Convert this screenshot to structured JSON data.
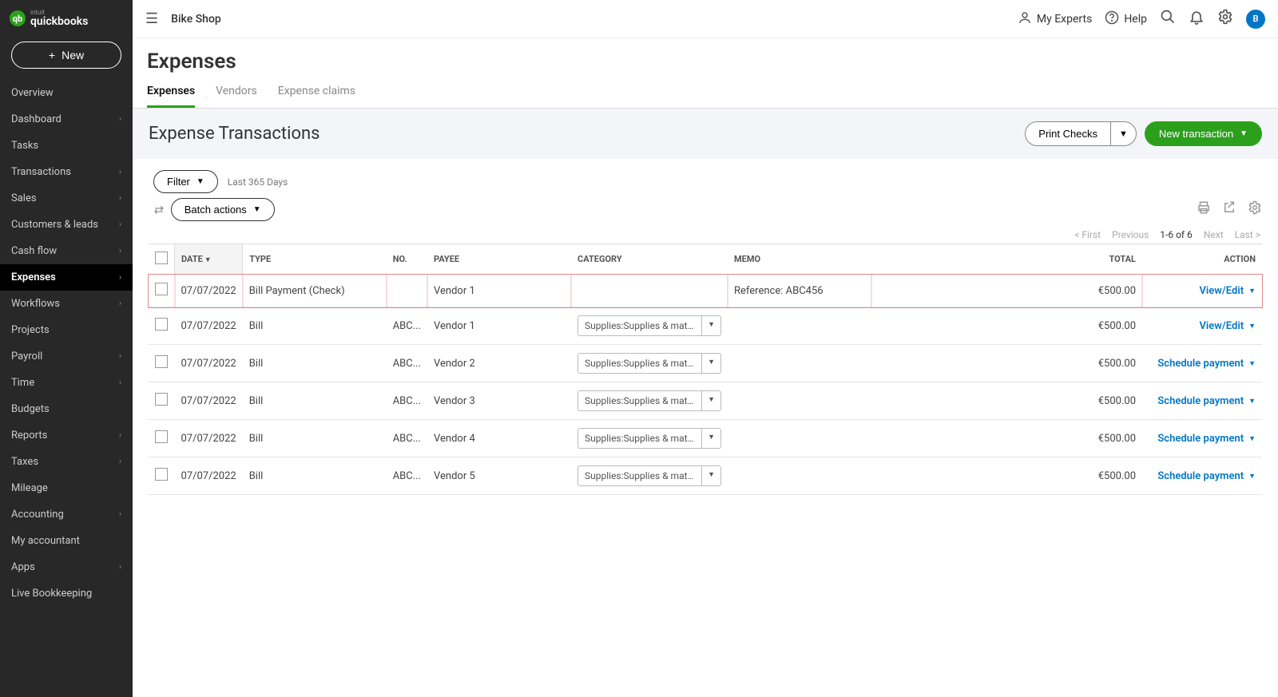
{
  "brand": {
    "intuit": "intuit",
    "name": "quickbooks",
    "icon_letter": "qb"
  },
  "sidebar": {
    "new_label": "New",
    "items": [
      {
        "label": "Overview",
        "chev": false
      },
      {
        "label": "Dashboard",
        "chev": true
      },
      {
        "label": "Tasks",
        "chev": false
      },
      {
        "label": "Transactions",
        "chev": true
      },
      {
        "label": "Sales",
        "chev": true
      },
      {
        "label": "Customers & leads",
        "chev": true
      },
      {
        "label": "Cash flow",
        "chev": true
      },
      {
        "label": "Expenses",
        "chev": true,
        "active": true
      },
      {
        "label": "Workflows",
        "chev": true
      },
      {
        "label": "Projects",
        "chev": false
      },
      {
        "label": "Payroll",
        "chev": true
      },
      {
        "label": "Time",
        "chev": true
      },
      {
        "label": "Budgets",
        "chev": false
      },
      {
        "label": "Reports",
        "chev": true
      },
      {
        "label": "Taxes",
        "chev": true
      },
      {
        "label": "Mileage",
        "chev": false
      },
      {
        "label": "Accounting",
        "chev": true
      },
      {
        "label": "My accountant",
        "chev": false
      },
      {
        "label": "Apps",
        "chev": true
      },
      {
        "label": "Live Bookkeeping",
        "chev": false
      }
    ]
  },
  "topbar": {
    "company": "Bike Shop",
    "my_experts": "My Experts",
    "help": "Help",
    "avatar_letter": "B"
  },
  "page": {
    "title": "Expenses",
    "tabs": [
      {
        "label": "Expenses",
        "active": true
      },
      {
        "label": "Vendors"
      },
      {
        "label": "Expense claims"
      }
    ],
    "subheader_title": "Expense Transactions",
    "print_checks": "Print Checks",
    "new_transaction": "New transaction",
    "filter_label": "Filter",
    "filter_meta": "Last 365 Days",
    "batch_label": "Batch actions"
  },
  "paging": {
    "first": "< First",
    "previous": "Previous",
    "range": "1-6 of 6",
    "next": "Next",
    "last": "Last >"
  },
  "table": {
    "columns": {
      "date": "DATE",
      "type": "TYPE",
      "no": "NO.",
      "payee": "PAYEE",
      "category": "CATEGORY",
      "memo": "MEMO",
      "total": "TOTAL",
      "action": "ACTION"
    },
    "category_value": "Supplies:Supplies & materials",
    "rows": [
      {
        "date": "07/07/2022",
        "type": "Bill Payment (Check)",
        "no": "",
        "payee": "Vendor 1",
        "category": "",
        "memo": "Reference: ABC456",
        "total": "€500.00",
        "action": "View/Edit",
        "highlight": true
      },
      {
        "date": "07/07/2022",
        "type": "Bill",
        "no": "ABC...",
        "payee": "Vendor 1",
        "category": "select",
        "memo": "",
        "total": "€500.00",
        "action": "View/Edit"
      },
      {
        "date": "07/07/2022",
        "type": "Bill",
        "no": "ABC...",
        "payee": "Vendor 2",
        "category": "select",
        "memo": "",
        "total": "€500.00",
        "action": "Schedule payment"
      },
      {
        "date": "07/07/2022",
        "type": "Bill",
        "no": "ABC...",
        "payee": "Vendor 3",
        "category": "select",
        "memo": "",
        "total": "€500.00",
        "action": "Schedule payment"
      },
      {
        "date": "07/07/2022",
        "type": "Bill",
        "no": "ABC...",
        "payee": "Vendor 4",
        "category": "select",
        "memo": "",
        "total": "€500.00",
        "action": "Schedule payment"
      },
      {
        "date": "07/07/2022",
        "type": "Bill",
        "no": "ABC...",
        "payee": "Vendor 5",
        "category": "select",
        "memo": "",
        "total": "€500.00",
        "action": "Schedule payment"
      }
    ]
  }
}
